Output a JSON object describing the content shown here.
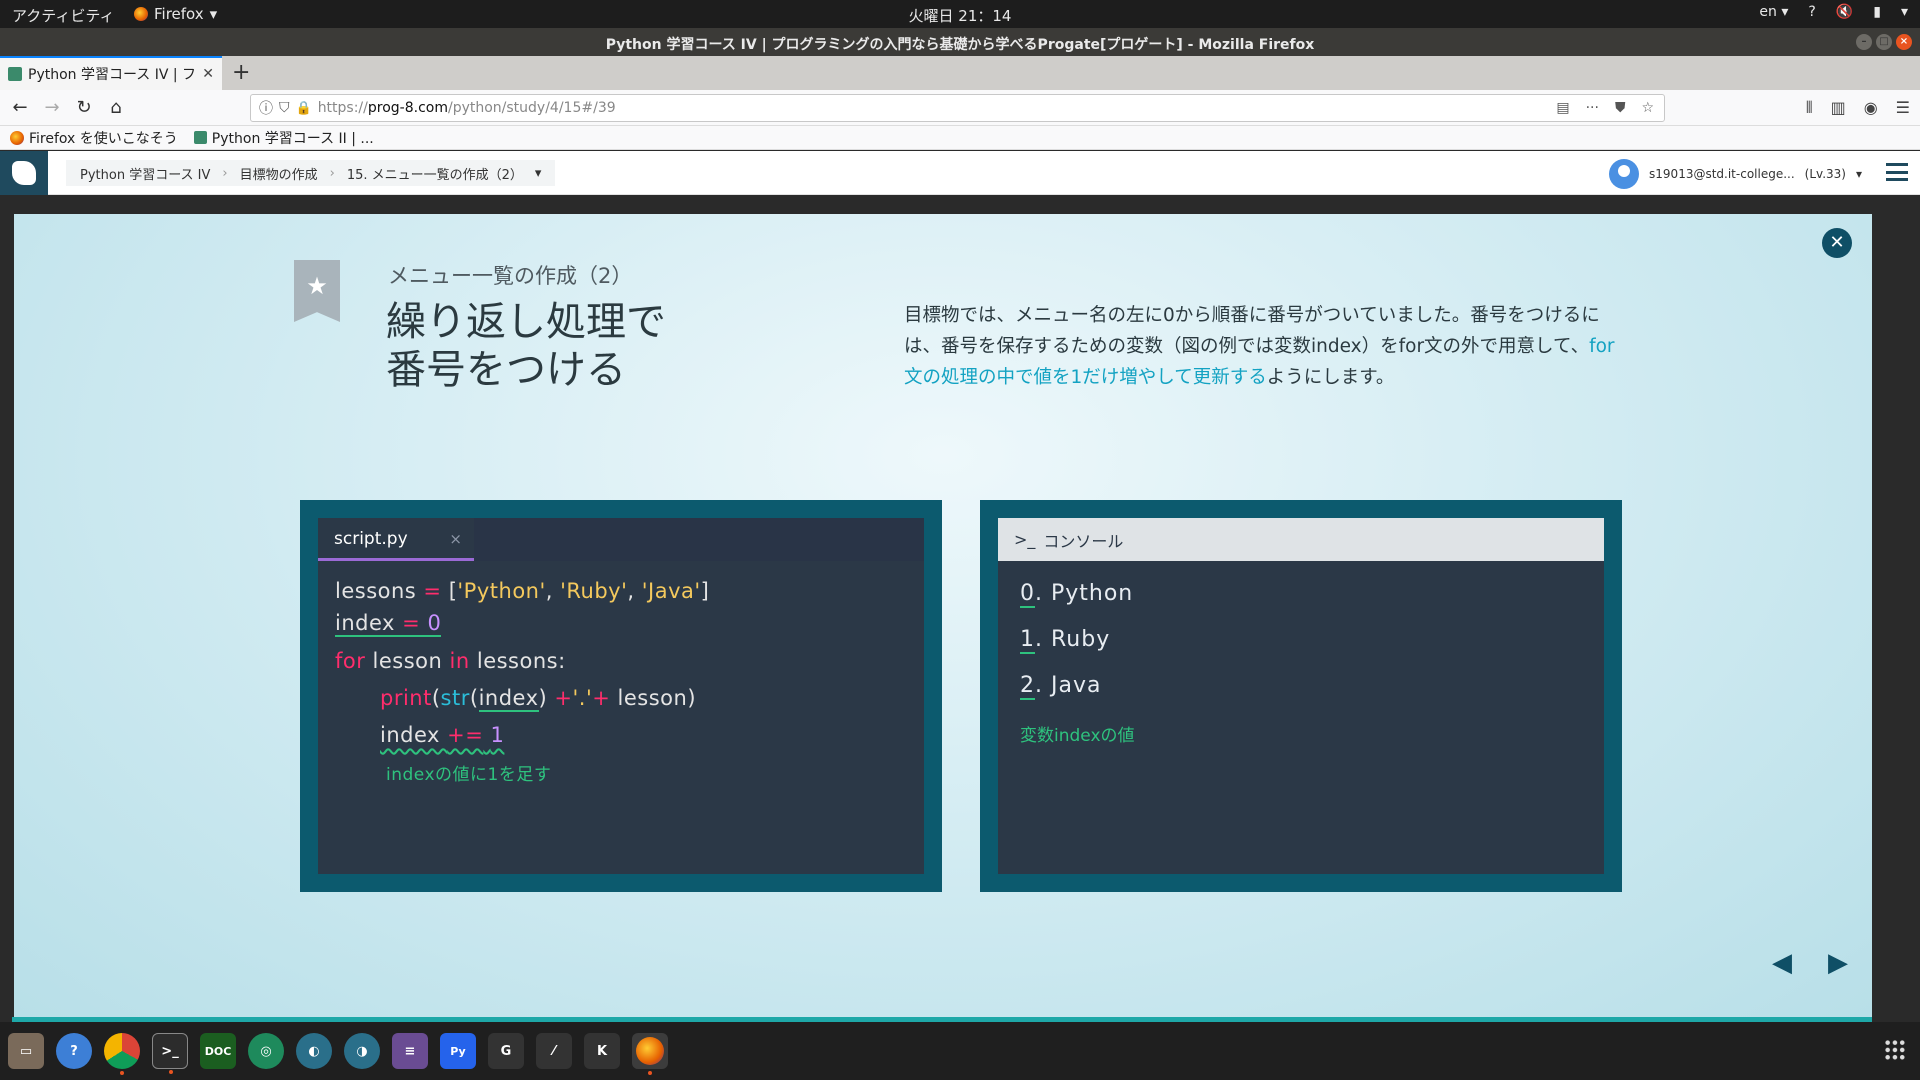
{
  "desktop": {
    "activities": "アクティビティ",
    "app_name": "Firefox",
    "clock": "火曜日 21：14",
    "lang": "en"
  },
  "window": {
    "title": "Python 学習コース IV | プログラミングの入門なら基礎から学べるProgate[プロゲート] - Mozilla Firefox"
  },
  "browser": {
    "tab_label": "Python 学習コース IV | フ",
    "new_tab": "+",
    "url_prefix": "https://",
    "url_domain": "prog-8.com",
    "url_path": "/python/study/4/15#/39",
    "bookmarks": [
      {
        "label": "Firefox を使いこなそう"
      },
      {
        "label": "Python 学習コース II | ..."
      }
    ]
  },
  "site": {
    "breadcrumbs": [
      "Python 学習コース IV",
      "目標物の作成",
      "15. メニュー一覧の作成（2）"
    ],
    "user_email": "s19013@std.it-college...",
    "user_level": "(Lv.33)"
  },
  "slide": {
    "subtitle": "メニュー一覧の作成（2）",
    "title_line1": "繰り返し処理で",
    "title_line2": "番号をつける",
    "desc_part1": "目標物では、メニュー名の左に0から順番に番号がついていました。番号をつけるには、番号を保存するための変数（図の例では変数index）をfor文の外で用意して、",
    "desc_highlight": "for文の処理の中で値を1だけ増やして更新する",
    "desc_part2": "ようにします。",
    "editor": {
      "filename": "script.py",
      "close": "×",
      "annotation": "indexの値に1を足す"
    },
    "console": {
      "header": "コンソール",
      "outputs": [
        {
          "num": "0",
          "text": ". Python"
        },
        {
          "num": "1",
          "text": ". Ruby"
        },
        {
          "num": "2",
          "text": ". Java"
        }
      ],
      "annotation": "変数indexの値"
    }
  },
  "colors": {
    "keyword": "#ff2d6c",
    "string": "#f4c95d",
    "number": "#c891ff",
    "builtin": "#2bbdd8",
    "annotation": "#2ec27e",
    "panel_frame": "#0c5a6e"
  }
}
